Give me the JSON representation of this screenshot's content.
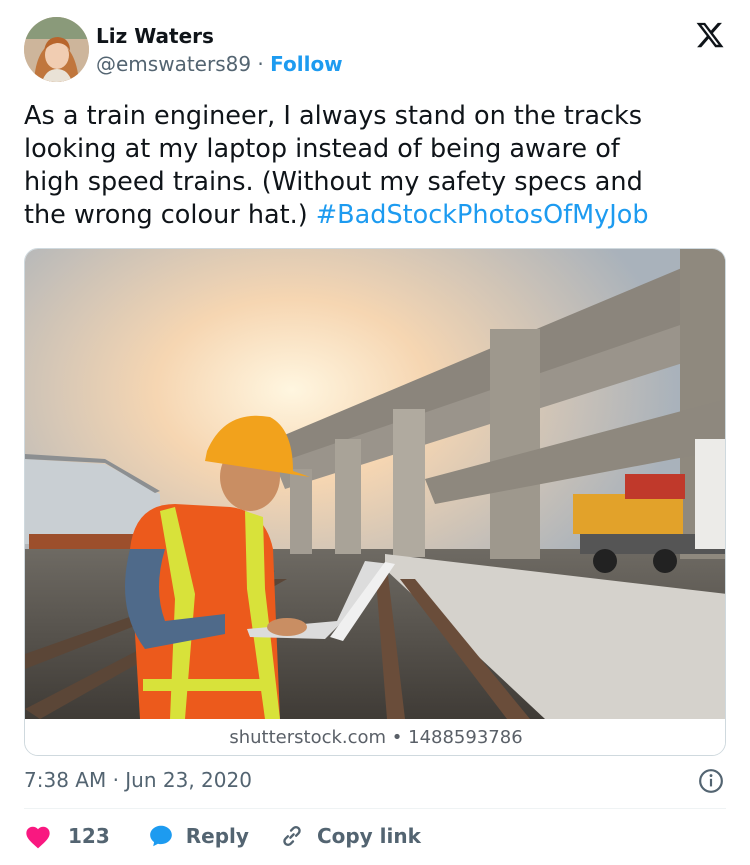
{
  "author": {
    "name": "Liz Waters",
    "handle": "@emswaters89",
    "separator": " · ",
    "follow_label": "Follow"
  },
  "tweet": {
    "lines": [
      "As a train engineer, I always stand on the tracks",
      "looking at my laptop instead of being aware of",
      "high speed trains. (Without my safety specs and"
    ],
    "last_line_text": "the wrong colour hat.) ",
    "hashtag": "#BadStockPhotosOfMyJob"
  },
  "media": {
    "caption": "shutterstock.com • 1488593786"
  },
  "meta": {
    "timestamp": "7:38 AM · Jun 23, 2020"
  },
  "actions": {
    "like_count": "123",
    "reply_label": "Reply",
    "copy_link_label": "Copy link"
  },
  "colors": {
    "accent": "#1d9bf0",
    "like": "#f91880",
    "text_primary": "#0f1419",
    "text_secondary": "#536471"
  },
  "icons": [
    "x-logo-icon",
    "heart-icon",
    "reply-bubble-icon",
    "link-icon",
    "info-icon"
  ]
}
